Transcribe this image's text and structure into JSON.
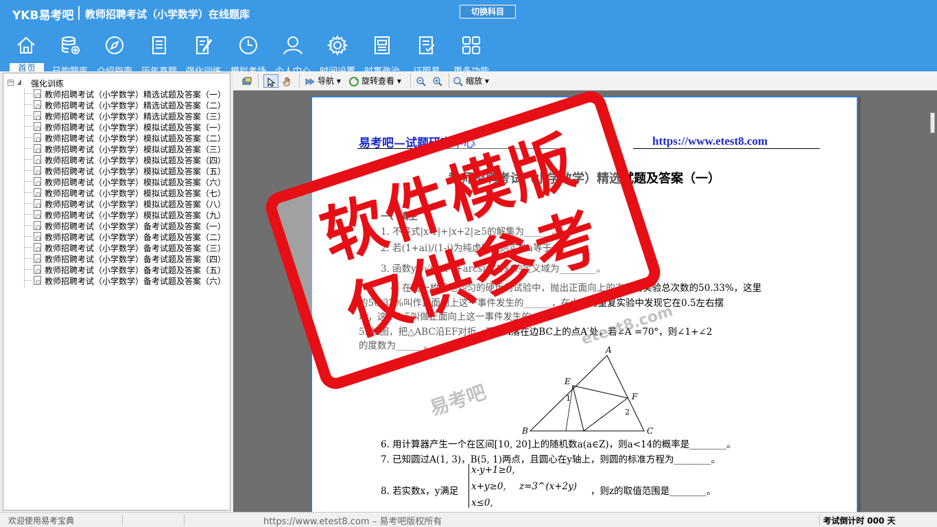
{
  "header": {
    "logo": "YKB易考吧",
    "title": "教师招聘考试（小学数学）在线题库",
    "switch_label": "切换科目"
  },
  "toolbar": [
    {
      "label": "首页",
      "icon": "home-icon"
    },
    {
      "label": "已购题库",
      "icon": "database-icon"
    },
    {
      "label": "介绍指南",
      "icon": "compass-icon"
    },
    {
      "label": "历年真题",
      "icon": "list-doc-icon"
    },
    {
      "label": "强化训练",
      "icon": "edit-doc-icon"
    },
    {
      "label": "模拟考场",
      "icon": "clock-icon"
    },
    {
      "label": "个人中心",
      "icon": "user-icon"
    },
    {
      "label": "时间设置",
      "icon": "gear-icon"
    },
    {
      "label": "时事政治",
      "icon": "newspaper-icon"
    },
    {
      "label": "证照易",
      "icon": "certificate-icon"
    },
    {
      "label": "更多功能",
      "icon": "grid-icon"
    }
  ],
  "tree": {
    "root": "强化训练",
    "items": [
      "教师招聘考试（小学数学）精选试题及答案（一）",
      "教师招聘考试（小学数学）精选试题及答案（二）",
      "教师招聘考试（小学数学）精选试题及答案（三）",
      "教师招聘考试（小学数学）模拟试题及答案（一）",
      "教师招聘考试（小学数学）模拟试题及答案（二）",
      "教师招聘考试（小学数学）模拟试题及答案（三）",
      "教师招聘考试（小学数学）模拟试题及答案（四）",
      "教师招聘考试（小学数学）模拟试题及答案（五）",
      "教师招聘考试（小学数学）模拟试题及答案（六）",
      "教师招聘考试（小学数学）模拟试题及答案（七）",
      "教师招聘考试（小学数学）模拟试题及答案（八）",
      "教师招聘考试（小学数学）模拟试题及答案（九）",
      "教师招聘考试（小学数学）备考试题及答案（一）",
      "教师招聘考试（小学数学）备考试题及答案（二）",
      "教师招聘考试（小学数学）备考试题及答案（三）",
      "教师招聘考试（小学数学）备考试题及答案（四）",
      "教师招聘考试（小学数学）备考试题及答案（五）",
      "教师招聘考试（小学数学）备考试题及答案（六）"
    ]
  },
  "viewer_toolbar": {
    "nav": "导航",
    "rotate": "旋转查看",
    "zoom": "缩放"
  },
  "document": {
    "header_left": "易考吧—试题研究中心",
    "header_right": "https://www.etest8.com",
    "title": "教师招聘考试（小学数学）精选试题及答案（一）",
    "lines": [
      "一、填空",
      "1. 不等式|x-1|+|x+2|≥5的解集为______。",
      "2. 若(1+ai)/(1-i)为纯虚数，则实数a等于________",
      "3. 函数y=√(2-x²)+arcsin(1/x)的定义域为________。",
      "4. 在抛一枚质地均匀的硬币的试验中，抛出正面向上的次数占实验总次数的50.33%，这里",
      "的50.33%叫作正面向上这一事件发生的______，在大量的重复实验中发现它在0.5左右摆",
      "动，这个0.5叫做正面向上这一事件发生的",
      "5. 如图，把△ABC沿EF对折，顶点A落在边BC上的点A′处，若∠A =70°，则∠1+∠2",
      "的度数为______。",
      "6. 用计算器产生一个在区间[10, 20]上的随机数a(a∈Z)，则a<14的概率是________。",
      "7. 已知圆过A(1, 3)，B(5, 1)两点，且圆心在y轴上，则圆的标准方程为________。",
      "8. 若实数x，y满足",
      "，则z的取值范围是________。"
    ],
    "system": [
      "x-y+1≥0,",
      "x+y≥0,",
      "x≤0,"
    ],
    "z_expr": "z=3^(x+2y)",
    "figure_labels": [
      "A",
      "E",
      "F",
      "B",
      "C",
      "1",
      "2"
    ],
    "watermark_brand": "易考吧",
    "watermark_url": "etest8.com"
  },
  "stamp": {
    "line1": "软件模版",
    "line2": "仅供参考"
  },
  "status": {
    "welcome": "欢迎使用易考宝典",
    "copyright": "https://www.etest8.com – 易考吧版权所有",
    "countdown": "考试倒计时 000 天"
  },
  "colors": {
    "brand_blue": "#3b99e6",
    "stamp_red": "#e60f15",
    "doc_header_blue": "#1a29c8"
  }
}
